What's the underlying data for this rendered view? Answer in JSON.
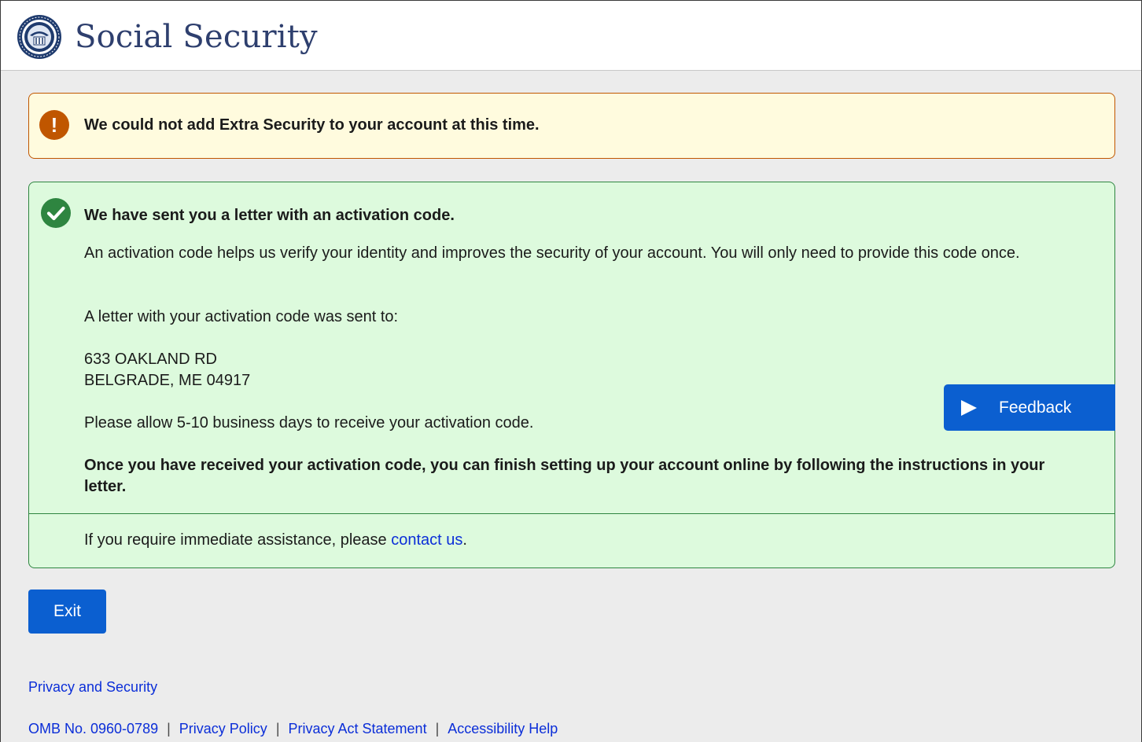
{
  "header": {
    "brand": "Social Security",
    "seal_icon": "ssa-seal-icon"
  },
  "warning_alert": {
    "icon": "exclamation-icon",
    "text": "We could not add Extra Security to your account at this time.",
    "color": "#c05600"
  },
  "success_alert": {
    "icon": "checkmark-icon",
    "title": "We have sent you a letter with an activation code.",
    "intro": "An activation code helps us verify your identity and improves the security of your account. You will only need to provide this code once.",
    "sent_to": "A letter with your activation code was sent to:",
    "address_line1": "633 OAKLAND RD",
    "address_line2": "BELGRADE, ME 04917",
    "allow": "Please allow 5-10 business days to receive your activation code.",
    "once_received": "Once you have received your activation code, you can finish setting up your account online by following the instructions in your letter.",
    "assist_prefix": "If you require immediate assistance, please ",
    "assist_link": "contact us",
    "assist_suffix": ".",
    "color": "#2e8540"
  },
  "feedback": {
    "label": "Feedback",
    "icon": "play-triangle-icon"
  },
  "actions": {
    "exit_label": "Exit"
  },
  "footer": {
    "privacy_security": "Privacy and Security",
    "omb": "OMB No. 0960-0789",
    "separator": "|",
    "privacy_policy": "Privacy Policy",
    "privacy_act": "Privacy Act Statement",
    "accessibility": "Accessibility Help"
  },
  "colors": {
    "primary_button": "#0b5fd0",
    "link": "#0b2ed8",
    "brand_text": "#2e3f6e"
  }
}
